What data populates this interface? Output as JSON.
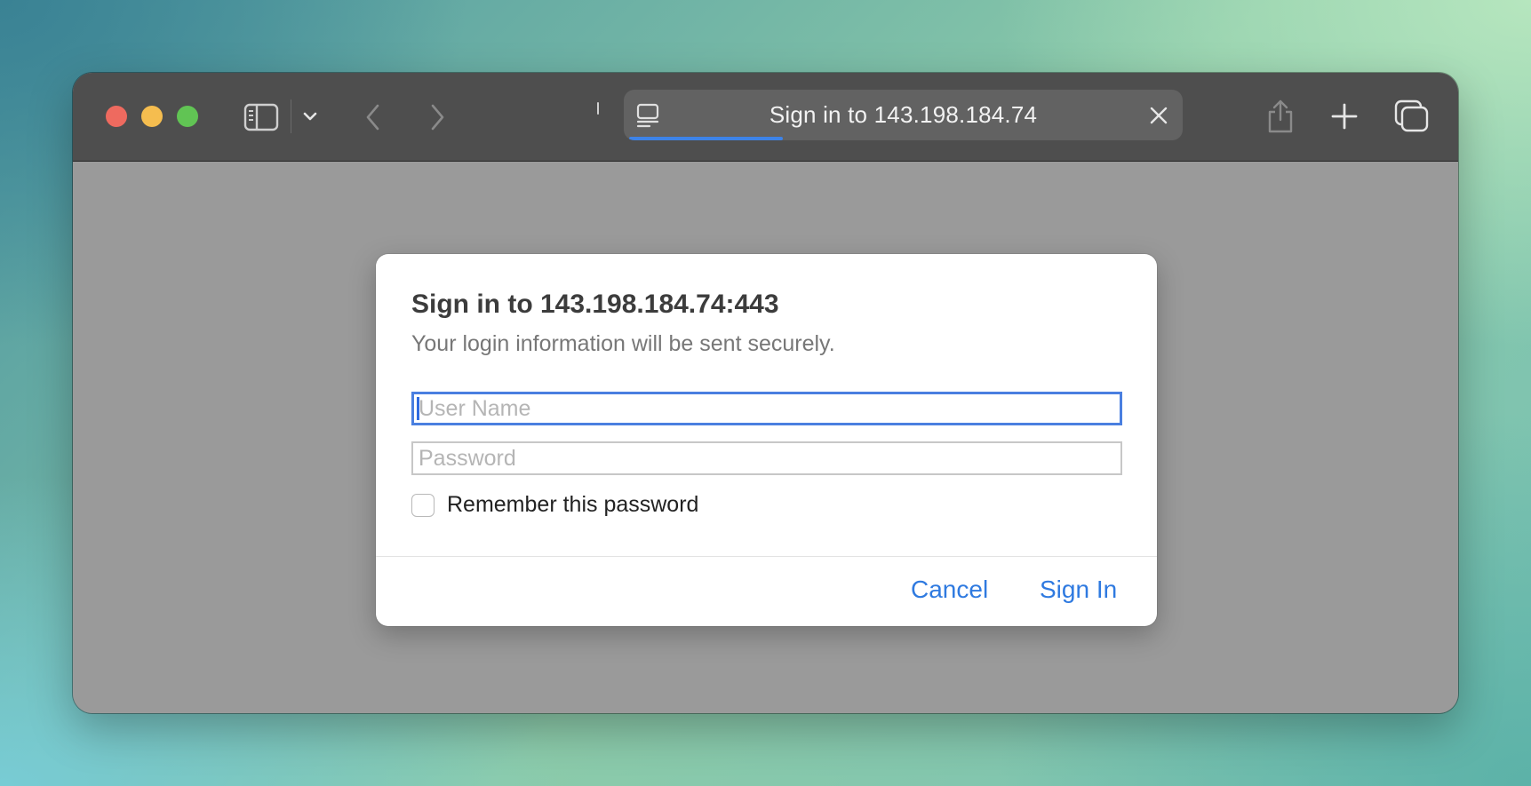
{
  "browser": {
    "address_title": "Sign in to 143.198.184.74",
    "page_load_progress": 0.28
  },
  "dialog": {
    "title": "Sign in to 143.198.184.74:443",
    "subtitle": "Your login information will be sent securely.",
    "username_placeholder": "User Name",
    "username_value": "",
    "password_placeholder": "Password",
    "password_value": "",
    "remember_label": "Remember this password",
    "remember_checked": false,
    "cancel_label": "Cancel",
    "signin_label": "Sign In"
  },
  "icons": {
    "sidebar": "sidebar-icon",
    "chevron": "chevron-down-icon",
    "back": "chevron-left-icon",
    "forward": "chevron-right-icon",
    "reader": "reader-mode-icon",
    "stop": "close-icon",
    "share": "share-icon",
    "new_tab": "plus-icon",
    "tab_overview": "tab-overview-icon"
  },
  "colors": {
    "accent": "#2f7ae0",
    "progress": "#3d83e8",
    "traffic_close": "#ee6a5f",
    "traffic_minimize": "#f5bd4f",
    "traffic_zoom": "#61c454"
  }
}
